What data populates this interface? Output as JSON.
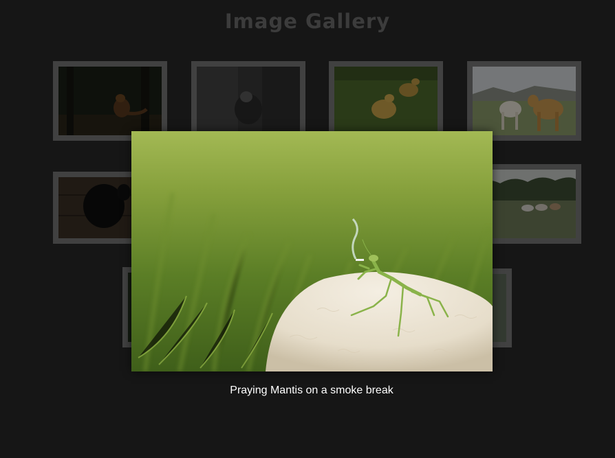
{
  "page": {
    "title": "Image Gallery"
  },
  "thumbnails": [
    {
      "subject": "fox-in-forest"
    },
    {
      "subject": "wolf-in-snow"
    },
    {
      "subject": "ducklings-in-grass"
    },
    {
      "subject": "horses-in-field"
    },
    {
      "subject": "black-dog"
    },
    {
      "subject": "horses-in-meadow"
    },
    {
      "subject": "forest"
    },
    {
      "subject": "forest-edge"
    }
  ],
  "lightbox": {
    "image": "praying-mantis-on-mushroom",
    "caption": "Praying Mantis on a smoke break"
  },
  "colors": {
    "background": "#161616",
    "thumb_border": "#414141",
    "title": "#3c3c3c",
    "caption": "#ffffff"
  }
}
